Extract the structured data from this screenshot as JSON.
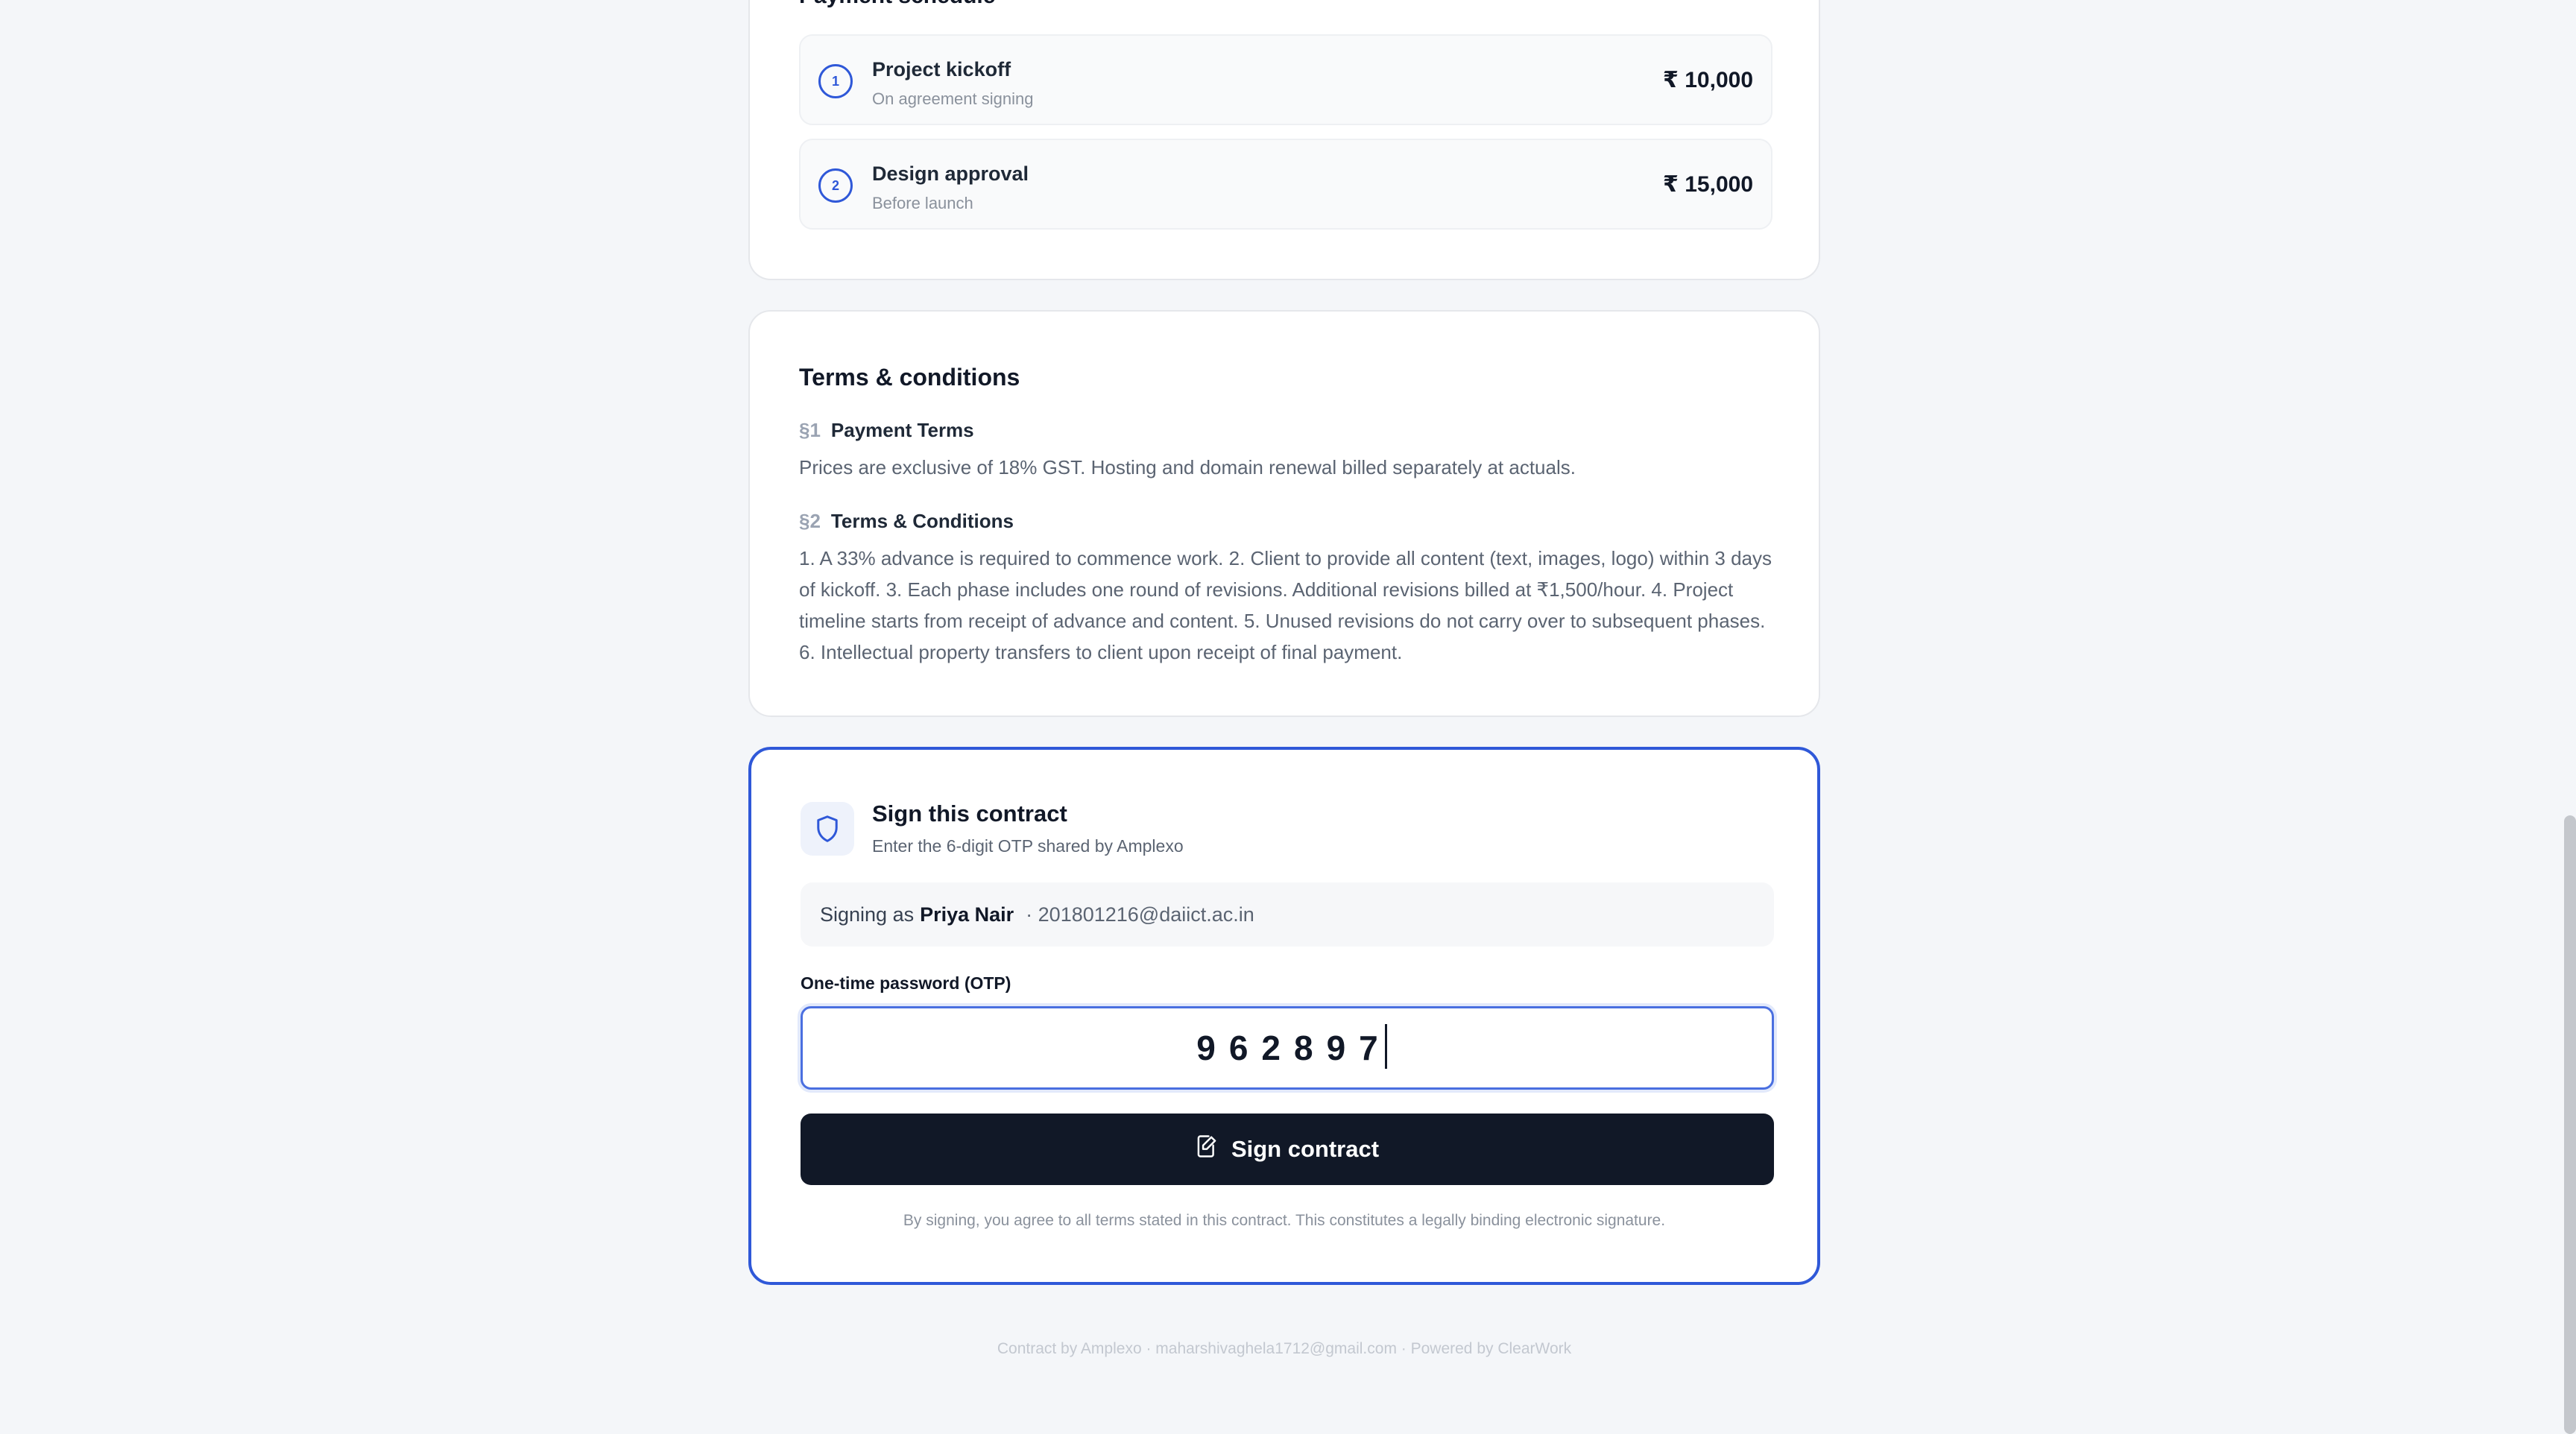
{
  "schedule": {
    "title": "Payment schedule",
    "milestones": [
      {
        "number": "1",
        "title": "Project kickoff",
        "subtitle": "On agreement signing",
        "amount": "₹ 10,000"
      },
      {
        "number": "2",
        "title": "Design approval",
        "subtitle": "Before launch",
        "amount": "₹ 15,000"
      }
    ]
  },
  "terms": {
    "heading": "Terms & conditions",
    "clauses": [
      {
        "section": "§1",
        "title": "Payment Terms",
        "body": "Prices are exclusive of 18% GST. Hosting and domain renewal billed separately at actuals."
      },
      {
        "section": "§2",
        "title": "Terms & Conditions",
        "body": "1. A 33% advance is required to commence work. 2. Client to provide all content (text, images, logo) within 3 days of kickoff. 3. Each phase includes one round of revisions. Additional revisions billed at ₹1,500/hour. 4. Project timeline starts from receipt of advance and content. 5. Unused revisions do not carry over to subsequent phases. 6. Intellectual property transfers to client upon receipt of final payment."
      }
    ]
  },
  "sign": {
    "icon": "shield-icon",
    "title": "Sign this contract",
    "subtitle": "Enter the 6-digit OTP shared by Amplexo",
    "signing_as_prefix": "Signing as",
    "signer_name": "Priya Nair",
    "signer_email": "· 201801216@daiict.ac.in",
    "otp_label": "One-time password (OTP)",
    "otp_value": "962897",
    "button_label": "Sign contract",
    "button_icon": "signature-icon",
    "disclaimer": "By signing, you agree to all terms stated in this contract. This constitutes a legally binding electronic signature.",
    "accent_color": "#2f58d8",
    "button_color": "#111827"
  },
  "footer": {
    "text": "Contract by Amplexo · maharshivaghela1712@gmail.com · Powered by ClearWork"
  }
}
